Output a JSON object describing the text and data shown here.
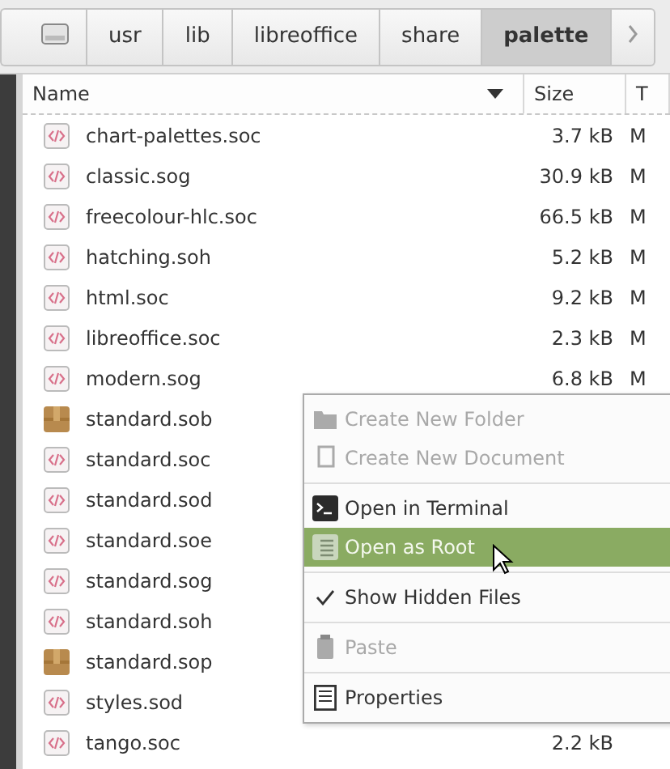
{
  "path_bar": {
    "items": [
      {
        "label": "usr",
        "selected": false
      },
      {
        "label": "lib",
        "selected": false
      },
      {
        "label": "libreoffice",
        "selected": false
      },
      {
        "label": "share",
        "selected": false
      },
      {
        "label": "palette",
        "selected": true
      }
    ]
  },
  "table": {
    "columns": [
      {
        "label": "Name",
        "sorted": true
      },
      {
        "label": "Size",
        "sorted": false
      },
      {
        "label": "T",
        "sorted": false
      }
    ],
    "rows": [
      {
        "name": "chart-palettes.soc",
        "kind": "code",
        "size": "3.7 kB",
        "column_3": "M"
      },
      {
        "name": "classic.sog",
        "kind": "code",
        "size": "30.9 kB",
        "column_3": "M"
      },
      {
        "name": "freecolour-hlc.soc",
        "kind": "code",
        "size": "66.5 kB",
        "column_3": "M"
      },
      {
        "name": "hatching.soh",
        "kind": "code",
        "size": "5.2 kB",
        "column_3": "M"
      },
      {
        "name": "html.soc",
        "kind": "code",
        "size": "9.2 kB",
        "column_3": "M"
      },
      {
        "name": "libreoffice.soc",
        "kind": "code",
        "size": "2.3 kB",
        "column_3": "M"
      },
      {
        "name": "modern.sog",
        "kind": "code",
        "size": "6.8 kB",
        "column_3": "M"
      },
      {
        "name": "standard.sob",
        "kind": "package"
      },
      {
        "name": "standard.soc",
        "kind": "code"
      },
      {
        "name": "standard.sod",
        "kind": "code"
      },
      {
        "name": "standard.soe",
        "kind": "code"
      },
      {
        "name": "standard.sog",
        "kind": "code"
      },
      {
        "name": "standard.soh",
        "kind": "code"
      },
      {
        "name": "standard.sop",
        "kind": "package"
      },
      {
        "name": "styles.sod",
        "kind": "code"
      },
      {
        "name": "tango.soc",
        "kind": "code",
        "size": "2.2 kB"
      }
    ]
  },
  "context_menu": {
    "items": [
      {
        "kind": "item",
        "label": "Create New Folder",
        "disabled": true,
        "selected": false,
        "checked": false
      },
      {
        "kind": "item",
        "label": "Create New Document",
        "disabled": true,
        "selected": false,
        "checked": false
      },
      {
        "kind": "separator"
      },
      {
        "kind": "item",
        "label": "Open in Terminal",
        "disabled": false,
        "selected": false,
        "checked": false
      },
      {
        "kind": "item",
        "label": "Open as Root",
        "disabled": false,
        "selected": true,
        "checked": false
      },
      {
        "kind": "separator"
      },
      {
        "kind": "item",
        "label": "Show Hidden Files",
        "disabled": false,
        "selected": false,
        "checked": true
      },
      {
        "kind": "separator"
      },
      {
        "kind": "item",
        "label": "Paste",
        "disabled": true,
        "selected": false,
        "checked": false
      },
      {
        "kind": "separator"
      },
      {
        "kind": "item",
        "label": "Properties",
        "disabled": false,
        "selected": false,
        "checked": false
      }
    ]
  }
}
